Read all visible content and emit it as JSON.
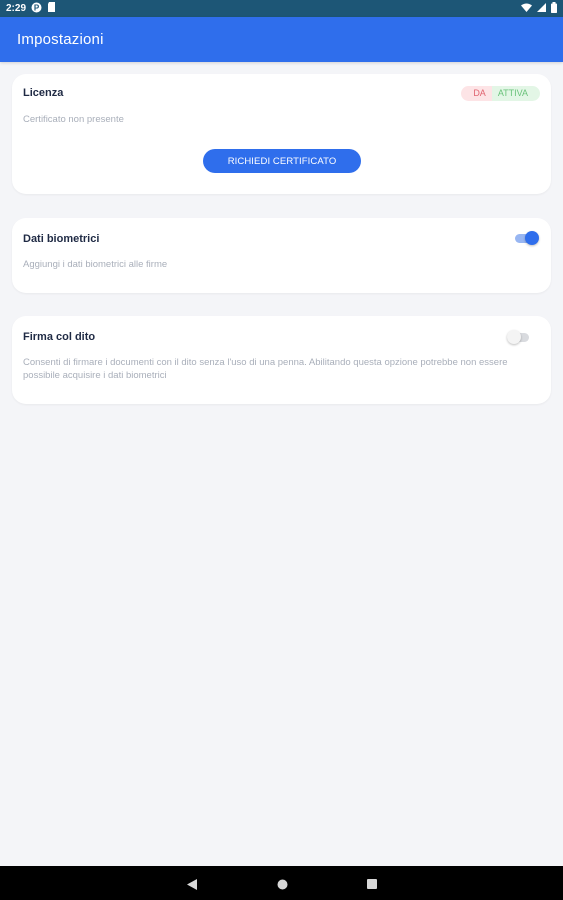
{
  "status_bar": {
    "time": "2:29",
    "left_icons": [
      "app-icon-p",
      "sd-card-icon"
    ],
    "right_icons": [
      "wifi-icon",
      "signal-icon",
      "battery-icon"
    ]
  },
  "app_bar": {
    "title": "Impostazioni"
  },
  "license_card": {
    "title": "Licenza",
    "badge_left": "DA",
    "badge_right": "ATTIVA",
    "description": "Certificato non presente",
    "button_label": "RICHIEDI CERTIFICATO"
  },
  "biometric_card": {
    "title": "Dati biometrici",
    "description": "Aggiungi i dati biometrici alle firme",
    "toggle_on": true
  },
  "finger_card": {
    "title": "Firma col dito",
    "description": "Consenti di firmare i documenti con il dito senza l'uso di una penna. Abilitando questa opzione potrebbe non essere possibile acquisire i dati biometrici",
    "toggle_on": false
  },
  "colors": {
    "primary": "#2f6eec",
    "status_bar": "#1d5676",
    "background": "#f4f5f8"
  },
  "nav_bar": {
    "buttons": [
      "back-icon",
      "home-icon",
      "recents-icon"
    ]
  }
}
